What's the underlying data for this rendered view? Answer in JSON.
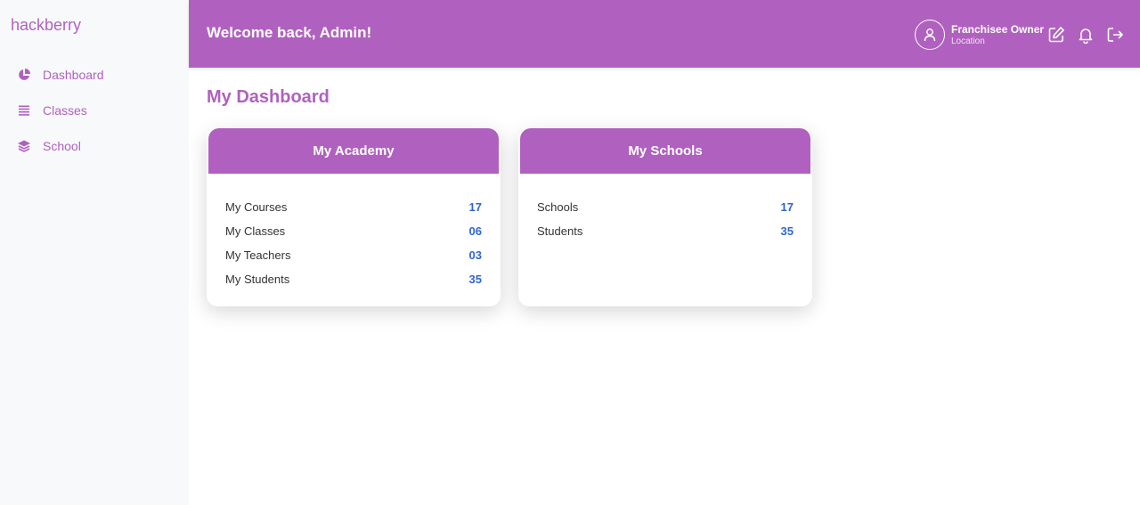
{
  "brand": "hackberry",
  "sidebar": {
    "items": [
      {
        "label": "Dashboard",
        "icon": "pie-chart-icon"
      },
      {
        "label": "Classes",
        "icon": "list-icon"
      },
      {
        "label": "School",
        "icon": "layers-icon"
      }
    ]
  },
  "header": {
    "welcome": "Welcome back, Admin!",
    "user_name": "Franchisee Owner",
    "user_location": "Location",
    "icons": [
      "edit-icon",
      "bell-icon",
      "logout-icon"
    ]
  },
  "page_title": "My Dashboard",
  "cards": [
    {
      "title": "My Academy",
      "rows": [
        {
          "label": "My Courses",
          "value": "17"
        },
        {
          "label": "My Classes",
          "value": "06"
        },
        {
          "label": "My Teachers",
          "value": "03"
        },
        {
          "label": "My Students",
          "value": "35"
        }
      ]
    },
    {
      "title": "My Schools",
      "rows": [
        {
          "label": "Schools",
          "value": "17"
        },
        {
          "label": "Students",
          "value": "35"
        }
      ]
    }
  ],
  "colors": {
    "accent": "#b061bf",
    "value": "#2f66d0",
    "sidebar_bg": "#f8f9fb"
  }
}
